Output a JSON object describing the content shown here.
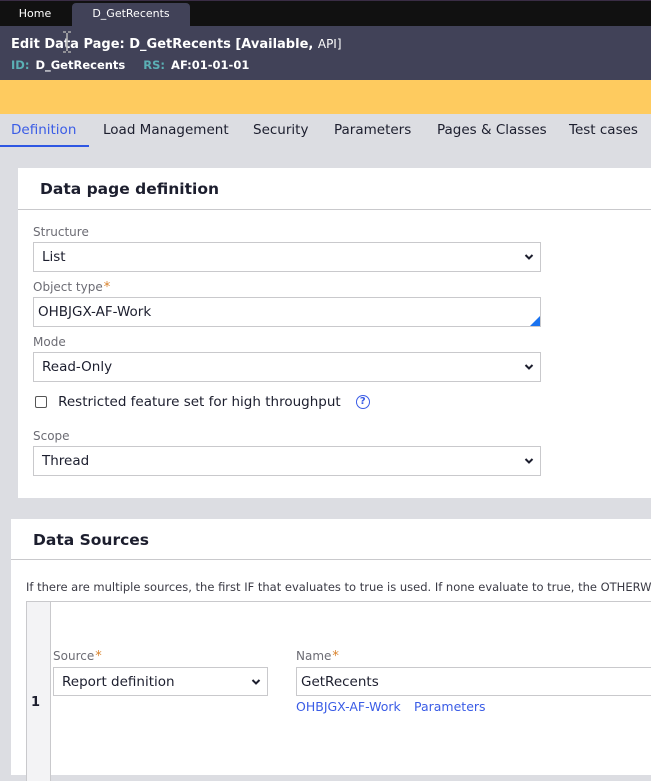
{
  "window_tabs": [
    {
      "label": "Home",
      "active": false
    },
    {
      "label": "D_GetRecents",
      "active": true
    }
  ],
  "header": {
    "title_prefix": "Edit  Data Page: D_GetRecents [Available,",
    "title_suffix": "API]",
    "id_label": "ID:",
    "id_value": "D_GetRecents",
    "rs_label": "RS:",
    "rs_value": "AF:01-01-01"
  },
  "colors": {
    "header_bg": "#414258",
    "banner": "#fecb5f",
    "accent": "#2f57e3",
    "required": "#d9822b",
    "link": "#3a5ce6"
  },
  "tabs": [
    {
      "label": "Definition",
      "active": true
    },
    {
      "label": "Load Management",
      "active": false
    },
    {
      "label": "Security",
      "active": false
    },
    {
      "label": "Parameters",
      "active": false
    },
    {
      "label": "Pages & Classes",
      "active": false
    },
    {
      "label": "Test cases",
      "active": false
    }
  ],
  "definition": {
    "title": "Data page definition",
    "structure": {
      "label": "Structure",
      "value": "List"
    },
    "object_type": {
      "label": "Object type",
      "required_mark": "*",
      "value": "OHBJGX-AF-Work"
    },
    "mode": {
      "label": "Mode",
      "value": "Read-Only"
    },
    "restricted": {
      "label": "Restricted feature set for high throughput",
      "checked": false,
      "help_icon": "?"
    },
    "scope": {
      "label": "Scope",
      "value": "Thread"
    }
  },
  "data_sources": {
    "title": "Data Sources",
    "info": "If there are multiple sources, the first IF that evaluates to true is used. If none evaluate to true, the OTHERWISE s",
    "rows": [
      {
        "number": "1",
        "source_label": "Source",
        "source_value": "Report definition",
        "name_label": "Name",
        "name_value": "GetRecents",
        "class_link": "OHBJGX-AF-Work",
        "params_link": "Parameters"
      }
    ],
    "required_mark": "*"
  }
}
